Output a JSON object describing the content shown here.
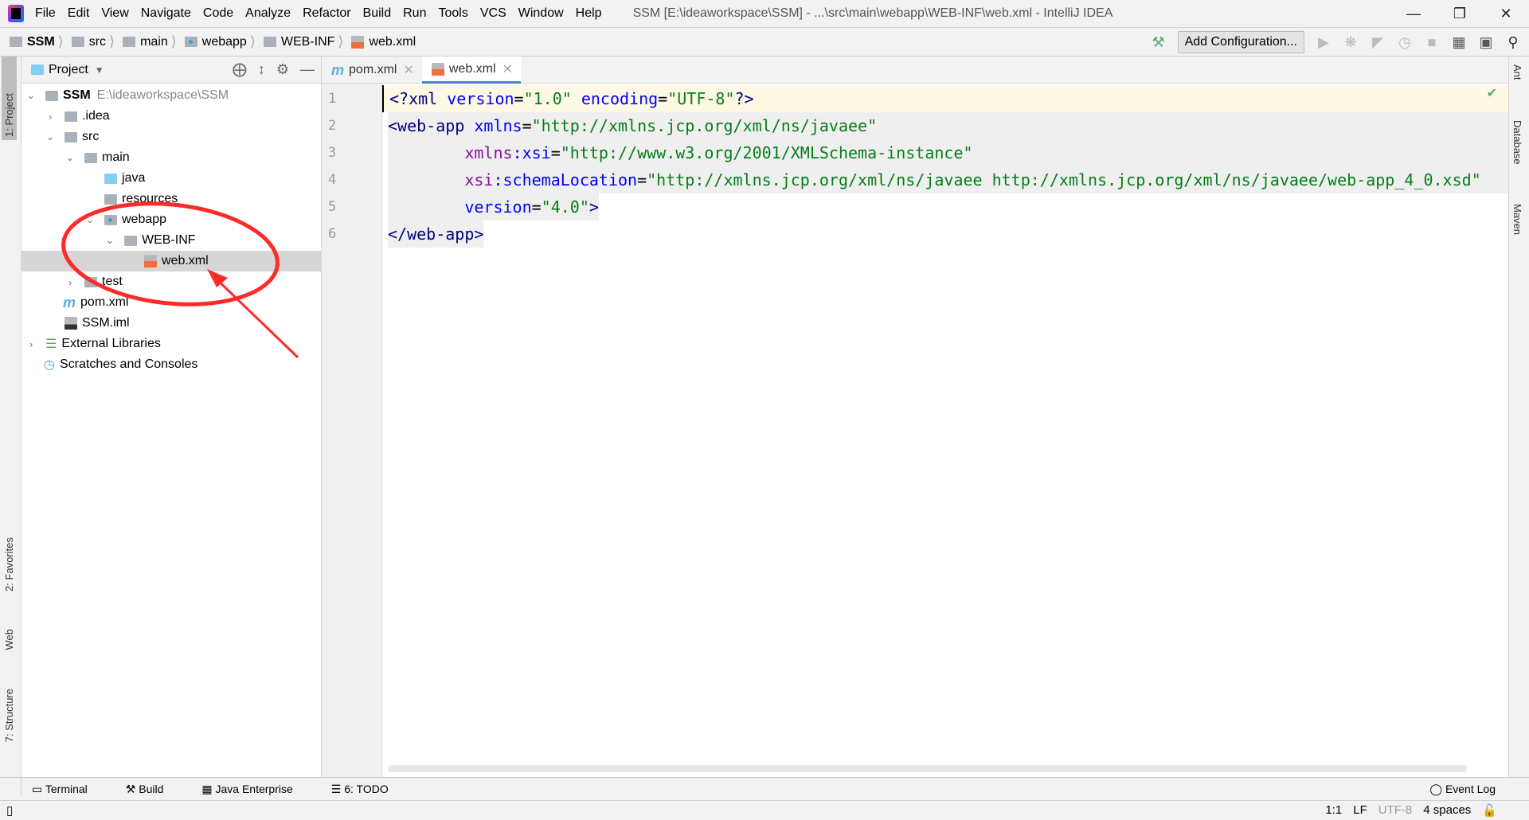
{
  "window": {
    "title": "SSM [E:\\ideaworkspace\\SSM] - ...\\src\\main\\webapp\\WEB-INF\\web.xml - IntelliJ IDEA"
  },
  "menu": [
    "File",
    "Edit",
    "View",
    "Navigate",
    "Code",
    "Analyze",
    "Refactor",
    "Build",
    "Run",
    "Tools",
    "VCS",
    "Window",
    "Help"
  ],
  "breadcrumb": [
    "SSM",
    "src",
    "main",
    "webapp",
    "WEB-INF",
    "web.xml"
  ],
  "toolbar": {
    "add_configuration": "Add Configuration..."
  },
  "project": {
    "title": "Project",
    "root_name": "SSM",
    "root_path": "E:\\ideaworkspace\\SSM",
    "items": [
      ".idea",
      "src",
      "main",
      "java",
      "resources",
      "webapp",
      "WEB-INF",
      "web.xml",
      "test",
      "pom.xml",
      "SSM.iml",
      "External Libraries",
      "Scratches and Consoles"
    ]
  },
  "tabs": [
    "pom.xml",
    "web.xml"
  ],
  "editor": {
    "line_numbers": [
      "1",
      "2",
      "3",
      "4",
      "5",
      "6"
    ]
  },
  "left_tabs": [
    "1: Project",
    "2: Favorites",
    "Web",
    "7: Structure"
  ],
  "right_tabs": [
    "Ant",
    "Database",
    "Maven"
  ],
  "bottom_tools": [
    "Terminal",
    "Build",
    "Java Enterprise",
    "6: TODO"
  ],
  "event_log": "Event Log",
  "status": {
    "position": "1:1",
    "line_sep": "LF",
    "encoding": "UTF-8",
    "indent": "4 spaces"
  },
  "colors": {
    "tag": "#000080",
    "attr": "#0000ff",
    "string": "#067d17",
    "namespace": "#871094",
    "annotation": "#ff2a2a",
    "tab_active": "#4083c9"
  }
}
